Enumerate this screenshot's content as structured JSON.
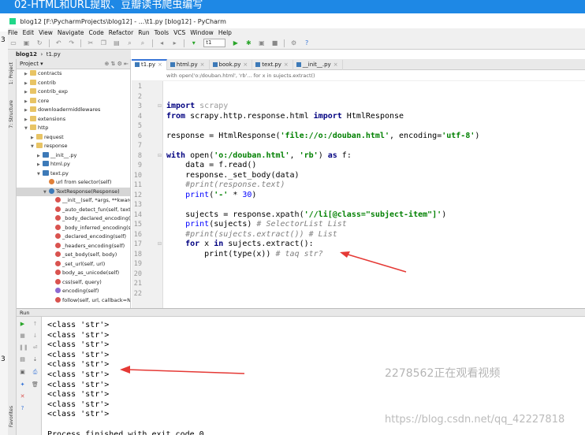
{
  "banner": {
    "title": "02-HTML和URL提取、豆瓣读书爬虫编写"
  },
  "window": {
    "title": "blog12 [F:\\PycharmProjects\\blog12] - ...\\t1.py [blog12] - PyCharm"
  },
  "menu": [
    "File",
    "Edit",
    "View",
    "Navigate",
    "Code",
    "Refactor",
    "Run",
    "Tools",
    "VCS",
    "Window",
    "Help"
  ],
  "toolbar": {
    "run_config": "t1"
  },
  "breadcrumb": {
    "project": "blog12",
    "file": "t1.py"
  },
  "edge_numbers": [
    "3",
    "3"
  ],
  "side_labels": {
    "project": "1: Project",
    "structure": "7: Structure",
    "favorites": "Favorites"
  },
  "project_panel": {
    "header": "Project",
    "tree": [
      {
        "indent": 1,
        "arrow": "▶",
        "icon": "folder",
        "label": "contracts"
      },
      {
        "indent": 1,
        "arrow": "▶",
        "icon": "folder",
        "label": "contrib"
      },
      {
        "indent": 1,
        "arrow": "▶",
        "icon": "folder",
        "label": "contrib_exp"
      },
      {
        "indent": 1,
        "arrow": "▶",
        "icon": "folder",
        "label": "core"
      },
      {
        "indent": 1,
        "arrow": "▶",
        "icon": "folder",
        "label": "downloadermiddlewares"
      },
      {
        "indent": 1,
        "arrow": "▶",
        "icon": "folder",
        "label": "extensions"
      },
      {
        "indent": 1,
        "arrow": "▼",
        "icon": "folder",
        "label": "http"
      },
      {
        "indent": 2,
        "arrow": "▶",
        "icon": "folder",
        "label": "request"
      },
      {
        "indent": 2,
        "arrow": "▼",
        "icon": "folder",
        "label": "response"
      },
      {
        "indent": 3,
        "arrow": "▶",
        "icon": "py",
        "label": "__init__.py"
      },
      {
        "indent": 3,
        "arrow": "▶",
        "icon": "py",
        "label": "html.py"
      },
      {
        "indent": 3,
        "arrow": "▼",
        "icon": "py",
        "label": "text.py"
      },
      {
        "indent": 4,
        "arrow": "",
        "icon": "fld",
        "label": "url from selector(self)"
      },
      {
        "indent": 4,
        "arrow": "▼",
        "icon": "cls",
        "label": "TextResponse(Response)",
        "selected": true
      },
      {
        "indent": 5,
        "arrow": "",
        "icon": "mth",
        "label": "__init__(self, *args, **kwargs)"
      },
      {
        "indent": 5,
        "arrow": "",
        "icon": "mth",
        "label": "_auto_detect_fun(self, text)"
      },
      {
        "indent": 5,
        "arrow": "",
        "icon": "mth",
        "label": "_body_declared_encoding(self)"
      },
      {
        "indent": 5,
        "arrow": "",
        "icon": "mth",
        "label": "_body_inferred_encoding(self)"
      },
      {
        "indent": 5,
        "arrow": "",
        "icon": "mth",
        "label": "_declared_encoding(self)"
      },
      {
        "indent": 5,
        "arrow": "",
        "icon": "mth",
        "label": "_headers_encoding(self)"
      },
      {
        "indent": 5,
        "arrow": "",
        "icon": "mth",
        "label": "_set_body(self, body)"
      },
      {
        "indent": 5,
        "arrow": "",
        "icon": "mth",
        "label": "_set_url(self, url)"
      },
      {
        "indent": 5,
        "arrow": "",
        "icon": "mth",
        "label": "body_as_unicode(self)"
      },
      {
        "indent": 5,
        "arrow": "",
        "icon": "mth",
        "label": "css(self, query)"
      },
      {
        "indent": 5,
        "arrow": "",
        "icon": "prop",
        "label": "encoding(self)"
      },
      {
        "indent": 5,
        "arrow": "",
        "icon": "mth",
        "label": "follow(self, url, callback=None)"
      }
    ]
  },
  "tabs": [
    {
      "label": "t1.py",
      "active": true
    },
    {
      "label": "html.py"
    },
    {
      "label": "book.py"
    },
    {
      "label": "text.py"
    },
    {
      "label": "__init__.py"
    }
  ],
  "editor": {
    "breadcrumb": "with open('o:/douban.html', 'rb'...    for x in sujects.extract()",
    "current_line": 18,
    "line_numbers": [
      1,
      2,
      3,
      4,
      5,
      6,
      7,
      8,
      9,
      10,
      11,
      12,
      13,
      14,
      15,
      16,
      17,
      18,
      19,
      20,
      21,
      22
    ],
    "code": [
      {
        "n": 3,
        "html": "<span class=\"kw\">import</span> <span class=\"dim\">scrapy</span>"
      },
      {
        "n": 4,
        "html": "<span class=\"kw\">from</span> scrapy.http.response.html <span class=\"kw\">import</span> HtmlResponse"
      },
      {
        "n": 6,
        "html": "response = HtmlResponse(<span class=\"st\">'file://o:/douban.html'</span>, encoding=<span class=\"st\">'utf-8'</span>)"
      },
      {
        "n": 8,
        "html": "<span class=\"kw\">with</span> open(<span class=\"st\">'o:/douban.html'</span>, <span class=\"st\">'rb'</span>) <span class=\"kw\">as</span> f:"
      },
      {
        "n": 9,
        "html": "    data = f.read()"
      },
      {
        "n": 10,
        "html": "    response._set_body(data)"
      },
      {
        "n": 11,
        "html": "    <span class=\"cm\">#print(response.text)</span>"
      },
      {
        "n": 12,
        "html": "    <span class=\"nm\">print</span>(<span class=\"st\">'-'</span> * <span class=\"nm\">30</span>)"
      },
      {
        "n": 14,
        "html": "    sujects = response.xpath(<span class=\"st\">'//li[@class=\"subject-item\"]'</span>)"
      },
      {
        "n": 15,
        "html": "    <span class=\"nm\">print</span>(sujects) <span class=\"cm\"># SelectorList List</span>"
      },
      {
        "n": 16,
        "html": "    <span class=\"cm\">#print(sujects.extract()) # List</span>"
      },
      {
        "n": 17,
        "html": "    <span class=\"kw\">for</span> x <span class=\"kw\">in</span> sujects.extract():"
      },
      {
        "n": 18,
        "html": "        print(type(x)) <span class=\"cm\"># taq str?</span>"
      }
    ]
  },
  "run_panel": {
    "header": "Run",
    "output": [
      "<class 'str'>",
      "<class 'str'>",
      "<class 'str'>",
      "<class 'str'>",
      "<class 'str'>",
      "<class 'str'>",
      "<class 'str'>",
      "<class 'str'>",
      "<class 'str'>",
      "<class 'str'>",
      "",
      "Process finished with exit code 0"
    ]
  },
  "watermark": {
    "text": "2278562正在观看视频",
    "url": "https://blog.csdn.net/qq_42227818"
  },
  "colors": {
    "banner": "#1e88e5",
    "annotation_arrow": "#e53935",
    "keyword": "#000080",
    "string": "#008000"
  }
}
